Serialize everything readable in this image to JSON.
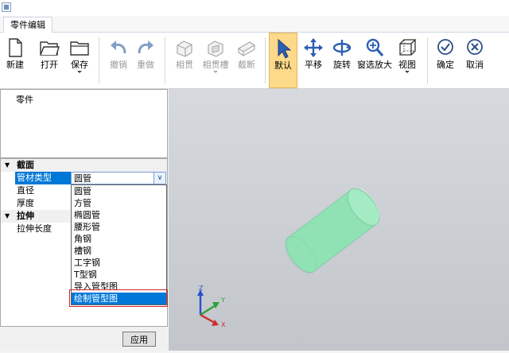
{
  "tab_label": "零件编辑",
  "toolbar": {
    "new_label": "新建",
    "open_label": "打开",
    "save_label": "保存",
    "undo_label": "撤销",
    "redo_label": "重做",
    "intersect_label": "相贯",
    "intersect_groove_label": "相贯槽",
    "cut_label": "截断",
    "default_label": "默认",
    "pan_label": "平移",
    "rotate_label": "旋转",
    "zoom_window_label": "窗选放大",
    "view_label": "视图",
    "ok_label": "确定",
    "cancel_label": "取消"
  },
  "parts_panel": {
    "title": "零件"
  },
  "properties": {
    "section_profile": "截面",
    "pipe_type_label": "管材类型",
    "pipe_type_value": "圆管",
    "diameter_label": "直径",
    "thickness_label": "厚度",
    "section_extrude": "拉伸",
    "extrude_length_label": "拉伸长度"
  },
  "dropdown": {
    "options": [
      "圆管",
      "方管",
      "椭圆管",
      "腰形管",
      "角钢",
      "槽钢",
      "工字钢",
      "T型钢",
      "导入管型图",
      "绘制管型图"
    ],
    "selected_index": 9
  },
  "apply_label": "应用",
  "axes": {
    "x": "X",
    "y": "Y",
    "z": "Z"
  },
  "colors": {
    "accent_selection": "#0078d7",
    "active_button_bg": "#fdd98a",
    "cylinder": "#90e2b5",
    "axis_x": "#d02b2b",
    "axis_y": "#2aa33a",
    "axis_z": "#2a52c9",
    "highlight_border": "#d4262b"
  }
}
